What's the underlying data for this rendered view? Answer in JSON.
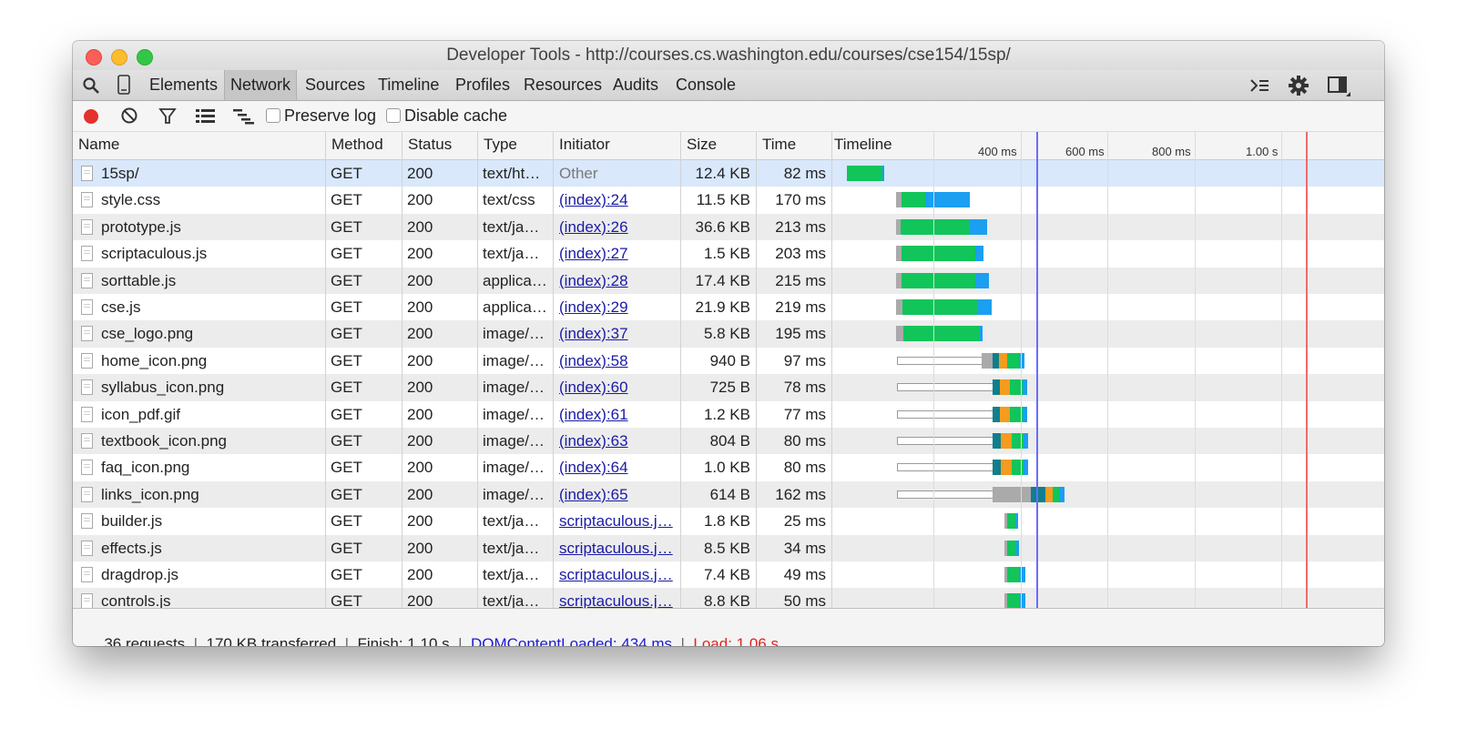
{
  "window": {
    "title": "Developer Tools - http://courses.cs.washington.edu/courses/cse154/15sp/"
  },
  "tabs": [
    "Elements",
    "Network",
    "Sources",
    "Timeline",
    "Profiles",
    "Resources",
    "Audits",
    "Console"
  ],
  "active_tab": "Network",
  "toolbar": {
    "preserve_log": "Preserve log",
    "disable_cache": "Disable cache"
  },
  "columns": {
    "name": "Name",
    "method": "Method",
    "status": "Status",
    "type": "Type",
    "initiator": "Initiator",
    "size": "Size",
    "time": "Time",
    "timeline": "Timeline"
  },
  "timeline_ticks": [
    "400 ms",
    "600 ms",
    "800 ms",
    "1.00 s"
  ],
  "timeline_markers": {
    "dom_content_loaded_ms": 434,
    "load_ms": 1060
  },
  "colors": {
    "dom_marker": "#6b6bff",
    "load_marker": "#ef6b6b",
    "receive": "#1b9ff0",
    "wait": "#11c55a",
    "queue": "#aaaaaa"
  },
  "requests": [
    {
      "name": "15sp/",
      "icon": "document-icon",
      "method": "GET",
      "status": "200",
      "type": "text/ht…",
      "initiator": "Other",
      "size": "12.4 KB",
      "time": "82 ms"
    },
    {
      "name": "style.css",
      "icon": "document-icon",
      "method": "GET",
      "status": "200",
      "type": "text/css",
      "initiator": "(index):24",
      "size": "11.5 KB",
      "time": "170 ms"
    },
    {
      "name": "prototype.js",
      "icon": "document-icon",
      "method": "GET",
      "status": "200",
      "type": "text/ja…",
      "initiator": "(index):26",
      "size": "36.6 KB",
      "time": "213 ms"
    },
    {
      "name": "scriptaculous.js",
      "icon": "document-icon",
      "method": "GET",
      "status": "200",
      "type": "text/ja…",
      "initiator": "(index):27",
      "size": "1.5 KB",
      "time": "203 ms"
    },
    {
      "name": "sorttable.js",
      "icon": "document-icon",
      "method": "GET",
      "status": "200",
      "type": "applica…",
      "initiator": "(index):28",
      "size": "17.4 KB",
      "time": "215 ms"
    },
    {
      "name": "cse.js",
      "icon": "document-icon",
      "method": "GET",
      "status": "200",
      "type": "applica…",
      "initiator": "(index):29",
      "size": "21.9 KB",
      "time": "219 ms"
    },
    {
      "name": "cse_logo.png",
      "icon": "image-icon",
      "method": "GET",
      "status": "200",
      "type": "image/…",
      "initiator": "(index):37",
      "size": "5.8 KB",
      "time": "195 ms"
    },
    {
      "name": "home_icon.png",
      "icon": "home-image-icon",
      "method": "GET",
      "status": "200",
      "type": "image/…",
      "initiator": "(index):58",
      "size": "940 B",
      "time": "97 ms"
    },
    {
      "name": "syllabus_icon.png",
      "icon": "image-icon",
      "method": "GET",
      "status": "200",
      "type": "image/…",
      "initiator": "(index):60",
      "size": "725 B",
      "time": "78 ms"
    },
    {
      "name": "icon_pdf.gif",
      "icon": "pdf-image-icon",
      "method": "GET",
      "status": "200",
      "type": "image/…",
      "initiator": "(index):61",
      "size": "1.2 KB",
      "time": "77 ms"
    },
    {
      "name": "textbook_icon.png",
      "icon": "book-image-icon",
      "method": "GET",
      "status": "200",
      "type": "image/…",
      "initiator": "(index):63",
      "size": "804 B",
      "time": "80 ms"
    },
    {
      "name": "faq_icon.png",
      "icon": "faq-image-icon",
      "method": "GET",
      "status": "200",
      "type": "image/…",
      "initiator": "(index):64",
      "size": "1.0 KB",
      "time": "80 ms"
    },
    {
      "name": "links_icon.png",
      "icon": "links-image-icon",
      "method": "GET",
      "status": "200",
      "type": "image/…",
      "initiator": "(index):65",
      "size": "614 B",
      "time": "162 ms"
    },
    {
      "name": "builder.js",
      "icon": "document-icon",
      "method": "GET",
      "status": "200",
      "type": "text/ja…",
      "initiator": "scriptaculous.j…",
      "size": "1.8 KB",
      "time": "25 ms"
    },
    {
      "name": "effects.js",
      "icon": "document-icon",
      "method": "GET",
      "status": "200",
      "type": "text/ja…",
      "initiator": "scriptaculous.j…",
      "size": "8.5 KB",
      "time": "34 ms"
    },
    {
      "name": "dragdrop.js",
      "icon": "document-icon",
      "method": "GET",
      "status": "200",
      "type": "text/ja…",
      "initiator": "scriptaculous.j…",
      "size": "7.4 KB",
      "time": "49 ms"
    },
    {
      "name": "controls.js",
      "icon": "document-icon",
      "method": "GET",
      "status": "200",
      "type": "text/ja…",
      "initiator": "scriptaculous.j…",
      "size": "8.8 KB",
      "time": "50 ms"
    }
  ],
  "status": {
    "requests": "36 requests",
    "transferred": "170 KB transferred",
    "finish": "Finish: 1.10 s",
    "dom": "DOMContentLoaded: 434 ms",
    "load": "Load: 1.06 s"
  }
}
